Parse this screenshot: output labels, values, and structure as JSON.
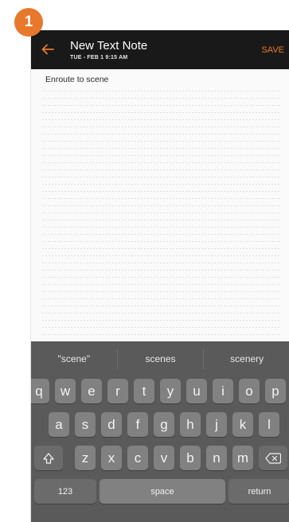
{
  "step_badge": "1",
  "header": {
    "title": "New Text Note",
    "subtitle": "TUE - FEB 1 9:15 AM",
    "save_label": "SAVE",
    "back_icon": "arrow-left-icon",
    "accent_color": "#e8782b",
    "bar_color": "#191919"
  },
  "note": {
    "text": "Enroute to scene"
  },
  "keyboard": {
    "suggestions": [
      "\"scene\"",
      "scenes",
      "scenery"
    ],
    "row1": [
      "q",
      "w",
      "e",
      "r",
      "t",
      "y",
      "u",
      "i",
      "o",
      "p"
    ],
    "row2": [
      "a",
      "s",
      "d",
      "f",
      "g",
      "h",
      "j",
      "k",
      "l"
    ],
    "row3": [
      "z",
      "x",
      "c",
      "v",
      "b",
      "n",
      "m"
    ],
    "shift_icon": "shift-icon",
    "backspace_icon": "backspace-icon",
    "numbers_label": "123",
    "space_label": "space",
    "return_label": "return"
  }
}
